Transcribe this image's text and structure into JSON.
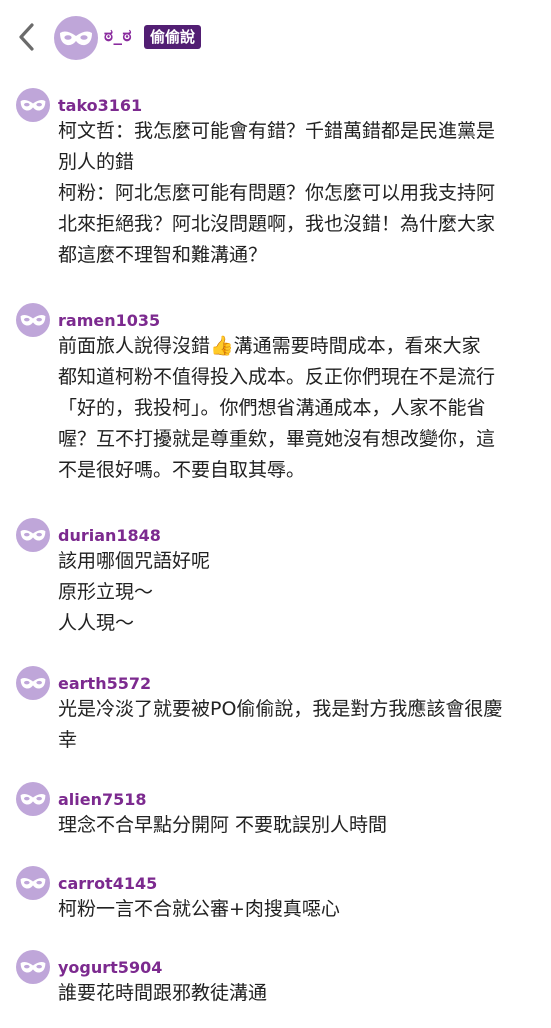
{
  "colors": {
    "avatar_bg": "#bfa6d9",
    "username": "#7c2a8f",
    "badge_bg": "#521e73"
  },
  "header": {
    "back_icon": "chevron-left-icon",
    "avatar_icon": "mask-icon",
    "name": "ಠ_ಠ",
    "badge": "偷偷說"
  },
  "comments": [
    {
      "username": "tako3161",
      "lines": [
        "柯文哲：我怎麼可能會有錯？千錯萬錯都是民進黨是",
        "別人的錯",
        "柯粉：阿北怎麼可能有問題？你怎麼可以用我支持阿",
        "北來拒絕我？阿北沒問題啊，我也沒錯！為什麼大家",
        "都這麼不理智和難溝通？"
      ]
    },
    {
      "username": "ramen1035",
      "lines": [
        "前面旅人說得沒錯👍溝通需要時間成本，看來大家",
        "都知道柯粉不值得投入成本。反正你們現在不是流行",
        "「好的，我投柯」。你們想省溝通成本，人家不能省",
        "喔？互不打擾就是尊重欸，畢竟她沒有想改變你，這",
        "不是很好嗎。不要自取其辱。"
      ]
    },
    {
      "username": "durian1848",
      "lines": [
        "該用哪個咒語好呢",
        "原形立現～",
        "人人現～"
      ]
    },
    {
      "username": "earth5572",
      "lines": [
        "光是冷淡了就要被PO偷偷說，我是對方我應該會很慶",
        "幸"
      ]
    },
    {
      "username": "alien7518",
      "lines": [
        "理念不合早點分開阿 不要耽誤別人時間"
      ]
    },
    {
      "username": "carrot4145",
      "lines": [
        "柯粉一言不合就公審+肉搜真噁心"
      ]
    },
    {
      "username": "yogurt5904",
      "lines": [
        "誰要花時間跟邪教徒溝通"
      ]
    }
  ]
}
